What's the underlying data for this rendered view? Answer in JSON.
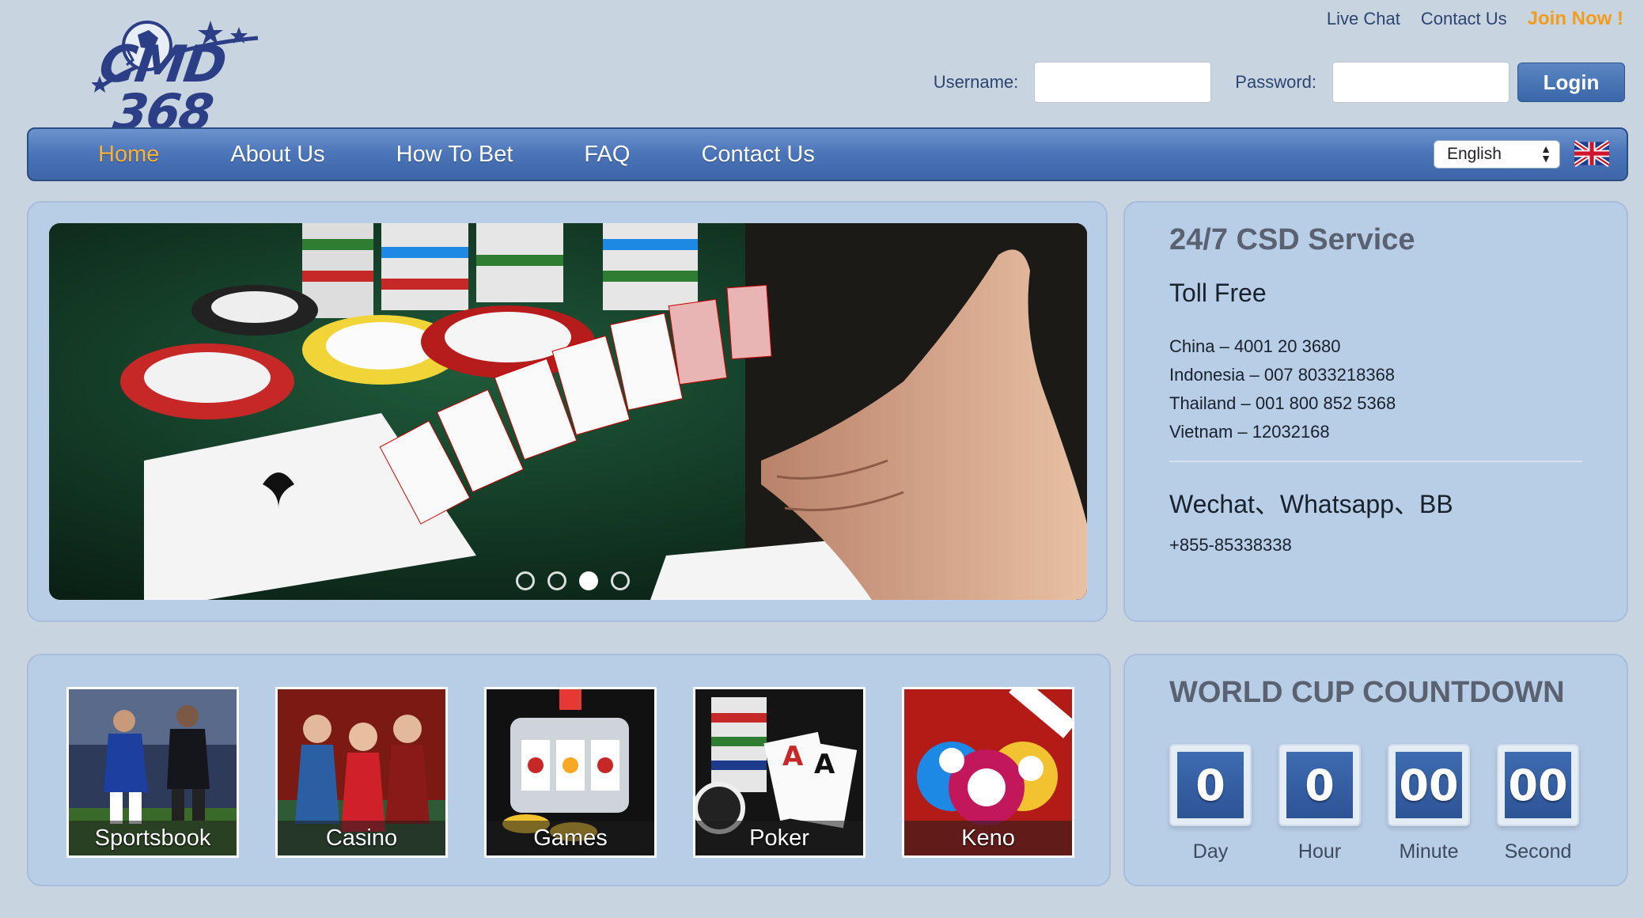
{
  "logo": {
    "line1": "CMD",
    "line2": "368"
  },
  "toplinks": {
    "live_chat": "Live Chat",
    "contact": "Contact Us",
    "join": "Join Now !"
  },
  "login": {
    "username_label": "Username:",
    "password_label": "Password:",
    "username_value": "",
    "password_value": "",
    "button": "Login"
  },
  "nav": {
    "items": [
      {
        "label": "Home",
        "active": true
      },
      {
        "label": "About Us"
      },
      {
        "label": "How To Bet"
      },
      {
        "label": "FAQ"
      },
      {
        "label": "Contact Us"
      }
    ],
    "language": "English"
  },
  "service": {
    "title": "24/7 CSD Service",
    "toll_free": "Toll Free",
    "numbers": [
      "China – 4001 20 3680",
      "Indonesia – 007 8033218368",
      "Thailand – 001 800 852 5368",
      "Vietnam – 12032168"
    ],
    "messaging": "Wechat、Whatsapp、BB",
    "phone": "+855-85338338"
  },
  "slider": {
    "dots": 4,
    "active_dot": 3
  },
  "games": [
    {
      "label": "Sportsbook"
    },
    {
      "label": "Casino"
    },
    {
      "label": "Games"
    },
    {
      "label": "Poker"
    },
    {
      "label": "Keno"
    }
  ],
  "countdown": {
    "title": "WORLD CUP COUNTDOWN",
    "units": [
      {
        "value": "0",
        "label": "Day"
      },
      {
        "value": "0",
        "label": "Hour"
      },
      {
        "value": "00",
        "label": "Minute"
      },
      {
        "value": "00",
        "label": "Second"
      }
    ]
  },
  "colors": {
    "accent_orange": "#f6b23a",
    "nav_blue": "#4a74b7",
    "panel": "#b8cde6",
    "background": "#c8d5e0"
  }
}
